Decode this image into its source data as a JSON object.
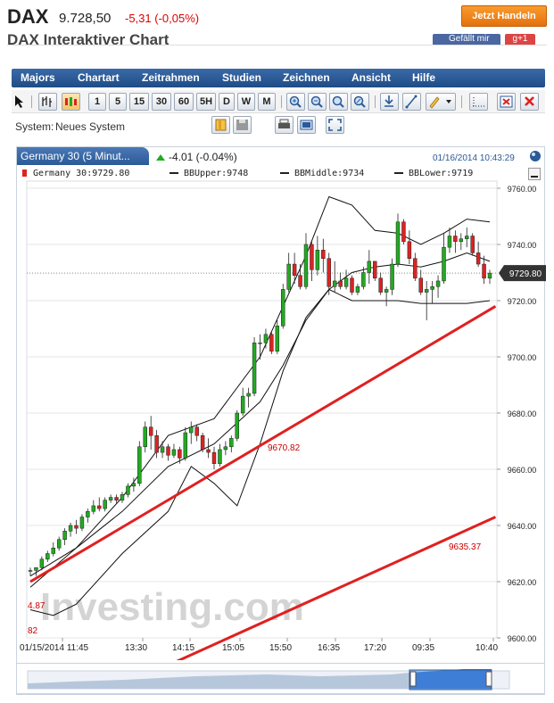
{
  "header": {
    "symbol": "DAX",
    "price": "9.728,50",
    "change": "-5,31 (-0,05%)",
    "trade_button": "Jetzt Handeln",
    "subtitle": "DAX Interaktiver Chart",
    "like_label": "Gefällt mir",
    "gplus_label": "g+1"
  },
  "menu": [
    "Majors",
    "Chartart",
    "Zeitrahmen",
    "Studien",
    "Zeichnen",
    "Ansicht",
    "Hilfe"
  ],
  "toolbar": {
    "timeframes": [
      "1",
      "5",
      "15",
      "30",
      "60",
      "5H",
      "D",
      "W",
      "M"
    ]
  },
  "system": {
    "label": "System:",
    "value": "Neues System"
  },
  "panel": {
    "tab_title": "Germany 30 (5 Minut...",
    "change": "-4.01 (-0.04%)",
    "datetime": "01/16/2014 10:43:29"
  },
  "legend": {
    "main": "Germany 30:9729.80",
    "upper": "BBUpper:9748",
    "middle": "BBMiddle:9734",
    "lower": "BBLower:9719"
  },
  "watermark": "Investing.com",
  "colors": {
    "up": "#22aa22",
    "down": "#dd2222",
    "trendline": "#e02020",
    "menubar": "#2a5a98",
    "trade_button": "#f08a1c"
  },
  "chart_data": {
    "type": "candlestick",
    "ylim": [
      9600,
      9760
    ],
    "yticks": [
      "9760.00",
      "9740.00",
      "9720.00",
      "9700.00",
      "9680.00",
      "9660.00",
      "9640.00",
      "9620.00",
      "9600.00"
    ],
    "xticks": [
      "01/15/2014 11:45",
      "13:30",
      "14:15",
      "15:05",
      "15:50",
      "16:35",
      "17:20",
      "09:35",
      "10:40"
    ],
    "last_price_label": "9729.80",
    "last_price": 9729.8,
    "annotations": [
      "9670.82",
      "9635.37"
    ],
    "partial_labels": [
      "4.87",
      "82"
    ],
    "candles": [
      [
        9624,
        9625,
        9622,
        9624
      ],
      [
        9624,
        9625,
        9622,
        9625
      ],
      [
        9625,
        9629,
        9624,
        9628
      ],
      [
        9628,
        9631,
        9627,
        9630
      ],
      [
        9630,
        9634,
        9629,
        9632
      ],
      [
        9632,
        9636,
        9631,
        9635
      ],
      [
        9635,
        9639,
        9633,
        9638
      ],
      [
        9638,
        9641,
        9636,
        9640
      ],
      [
        9640,
        9642,
        9637,
        9639
      ],
      [
        9639,
        9644,
        9638,
        9643
      ],
      [
        9643,
        9646,
        9641,
        9645
      ],
      [
        9645,
        9649,
        9644,
        9647
      ],
      [
        9647,
        9650,
        9645,
        9646
      ],
      [
        9646,
        9650,
        9645,
        9649
      ],
      [
        9649,
        9651,
        9648,
        9650
      ],
      [
        9650,
        9651,
        9648,
        9649
      ],
      [
        9649,
        9652,
        9648,
        9651
      ],
      [
        9651,
        9655,
        9650,
        9654
      ],
      [
        9654,
        9657,
        9652,
        9655
      ],
      [
        9655,
        9670,
        9654,
        9668
      ],
      [
        9668,
        9677,
        9666,
        9675
      ],
      [
        9675,
        9679,
        9667,
        9672
      ],
      [
        9672,
        9674,
        9664,
        9666
      ],
      [
        9666,
        9670,
        9664,
        9668
      ],
      [
        9668,
        9669,
        9663,
        9665
      ],
      [
        9665,
        9669,
        9664,
        9667
      ],
      [
        9667,
        9668,
        9662,
        9664
      ],
      [
        9664,
        9675,
        9663,
        9673
      ],
      [
        9673,
        9677,
        9669,
        9675
      ],
      [
        9675,
        9676,
        9670,
        9672
      ],
      [
        9672,
        9673,
        9666,
        9667
      ],
      [
        9667,
        9671,
        9664,
        9666
      ],
      [
        9666,
        9668,
        9660,
        9662
      ],
      [
        9662,
        9669,
        9661,
        9667
      ],
      [
        9667,
        9670,
        9665,
        9668
      ],
      [
        9668,
        9672,
        9666,
        9671
      ],
      [
        9671,
        9681,
        9670,
        9680
      ],
      [
        9680,
        9689,
        9679,
        9686
      ],
      [
        9686,
        9689,
        9682,
        9687
      ],
      [
        9687,
        9707,
        9686,
        9705
      ],
      [
        9705,
        9708,
        9699,
        9705
      ],
      [
        9705,
        9710,
        9703,
        9708
      ],
      [
        9708,
        9709,
        9701,
        9702
      ],
      [
        9702,
        9713,
        9701,
        9711
      ],
      [
        9711,
        9726,
        9710,
        9724
      ],
      [
        9724,
        9737,
        9723,
        9733
      ],
      [
        9733,
        9737,
        9726,
        9729
      ],
      [
        9729,
        9733,
        9724,
        9725
      ],
      [
        9725,
        9744,
        9724,
        9740
      ],
      [
        9740,
        9741,
        9727,
        9731
      ],
      [
        9731,
        9743,
        9729,
        9738
      ],
      [
        9738,
        9742,
        9730,
        9735
      ],
      [
        9735,
        9737,
        9722,
        9725
      ],
      [
        9725,
        9734,
        9723,
        9727
      ],
      [
        9727,
        9730,
        9724,
        9725
      ],
      [
        9725,
        9731,
        9724,
        9728
      ],
      [
        9728,
        9729,
        9722,
        9723
      ],
      [
        9723,
        9726,
        9722,
        9725
      ],
      [
        9725,
        9732,
        9724,
        9730
      ],
      [
        9730,
        9738,
        9726,
        9734
      ],
      [
        9734,
        9734,
        9727,
        9728
      ],
      [
        9728,
        9730,
        9722,
        9723
      ],
      [
        9723,
        9725,
        9718,
        9724
      ],
      [
        9724,
        9735,
        9722,
        9733
      ],
      [
        9733,
        9751,
        9732,
        9748
      ],
      [
        9748,
        9749,
        9740,
        9741
      ],
      [
        9741,
        9745,
        9733,
        9735
      ],
      [
        9735,
        9737,
        9727,
        9728
      ],
      [
        9728,
        9731,
        9722,
        9723
      ],
      [
        9723,
        9727,
        9713,
        9724
      ],
      [
        9724,
        9727,
        9719,
        9725
      ],
      [
        9725,
        9729,
        9721,
        9727
      ],
      [
        9727,
        9744,
        9726,
        9739
      ],
      [
        9739,
        9746,
        9737,
        9743
      ],
      [
        9743,
        9745,
        9737,
        9741
      ],
      [
        9741,
        9744,
        9738,
        9742
      ],
      [
        9742,
        9746,
        9739,
        9743
      ],
      [
        9743,
        9744,
        9736,
        9737
      ],
      [
        9737,
        9741,
        9732,
        9733
      ],
      [
        9733,
        9736,
        9726,
        9728
      ],
      [
        9728,
        9731,
        9726,
        9729.8
      ]
    ],
    "bb_upper": [
      [
        0,
        9618
      ],
      [
        8,
        9632
      ],
      [
        16,
        9650
      ],
      [
        24,
        9672
      ],
      [
        32,
        9678
      ],
      [
        40,
        9700
      ],
      [
        44,
        9718
      ],
      [
        48,
        9736
      ],
      [
        52,
        9757
      ],
      [
        56,
        9754
      ],
      [
        60,
        9745
      ],
      [
        64,
        9744
      ],
      [
        68,
        9740
      ],
      [
        72,
        9744
      ],
      [
        76,
        9749
      ],
      [
        80,
        9748
      ]
    ],
    "bb_middle": [
      [
        0,
        9622
      ],
      [
        8,
        9632
      ],
      [
        16,
        9645
      ],
      [
        24,
        9661
      ],
      [
        32,
        9669
      ],
      [
        40,
        9684
      ],
      [
        44,
        9697
      ],
      [
        48,
        9713
      ],
      [
        52,
        9724
      ],
      [
        56,
        9730
      ],
      [
        60,
        9732
      ],
      [
        64,
        9733
      ],
      [
        68,
        9732
      ],
      [
        72,
        9734
      ],
      [
        76,
        9737
      ],
      [
        80,
        9734
      ]
    ],
    "bb_lower": [
      [
        0,
        9610
      ],
      [
        4,
        9608
      ],
      [
        8,
        9612
      ],
      [
        16,
        9630
      ],
      [
        24,
        9645
      ],
      [
        28,
        9661
      ],
      [
        32,
        9655
      ],
      [
        36,
        9647
      ],
      [
        40,
        9669
      ],
      [
        44,
        9695
      ],
      [
        48,
        9714
      ],
      [
        52,
        9724
      ],
      [
        56,
        9720
      ],
      [
        60,
        9720
      ],
      [
        64,
        9720
      ],
      [
        68,
        9719
      ],
      [
        72,
        9719
      ],
      [
        76,
        9719
      ],
      [
        80,
        9720
      ]
    ],
    "trendlines": [
      {
        "start": [
          0,
          9620
        ],
        "end": [
          81,
          9718
        ]
      },
      {
        "start": [
          14,
          9581
        ],
        "end": [
          81,
          9643
        ]
      }
    ]
  }
}
